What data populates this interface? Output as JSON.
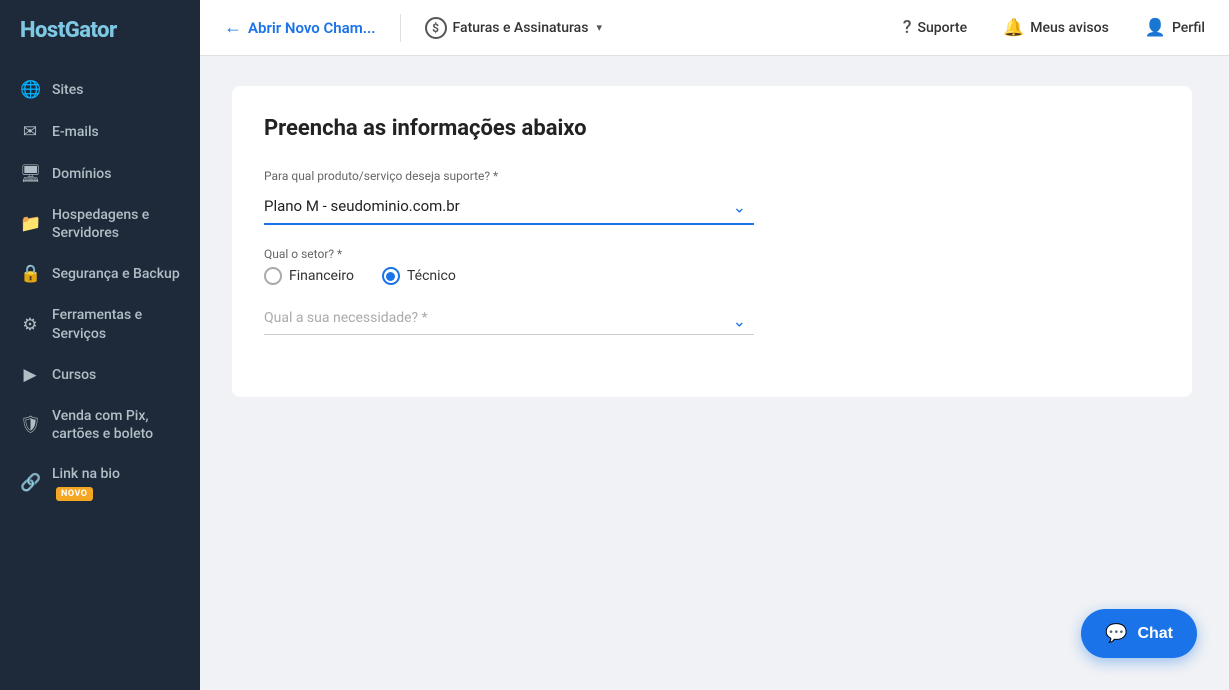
{
  "sidebar": {
    "logo": "HostGator",
    "items": [
      {
        "id": "sites",
        "label": "Sites",
        "icon": "🌐"
      },
      {
        "id": "emails",
        "label": "E-mails",
        "icon": "✉"
      },
      {
        "id": "dominios",
        "label": "Domínios",
        "icon": "🖥"
      },
      {
        "id": "hospedagens",
        "label": "Hospedagens e Servidores",
        "icon": "📁"
      },
      {
        "id": "seguranca",
        "label": "Segurança e Backup",
        "icon": "🔒"
      },
      {
        "id": "ferramentas",
        "label": "Ferramentas e Serviços",
        "icon": "⚙"
      },
      {
        "id": "cursos",
        "label": "Cursos",
        "icon": "▶"
      },
      {
        "id": "venda",
        "label": "Venda com Pix, cartões e boleto",
        "icon": "🛡"
      },
      {
        "id": "linkbio",
        "label": "Link na bio",
        "icon": "🔗",
        "badge": "NOVO"
      }
    ]
  },
  "topbar": {
    "back_label": "Abrir Novo Cham...",
    "faturas_label": "Faturas e Assinaturas",
    "suporte_label": "Suporte",
    "avisos_label": "Meus avisos",
    "perfil_label": "Perfil"
  },
  "form": {
    "title": "Preencha as informações abaixo",
    "product_label": "Para qual produto/serviço deseja suporte? *",
    "product_value": "Plano M - seudominio.com.br",
    "sector_label": "Qual o setor? *",
    "sector_options": [
      {
        "id": "financeiro",
        "label": "Financeiro",
        "selected": false
      },
      {
        "id": "tecnico",
        "label": "Técnico",
        "selected": true
      }
    ],
    "need_label": "Qual a sua necessidade? *",
    "need_placeholder": "Qual a sua necessidade? *"
  },
  "chat": {
    "label": "Chat"
  },
  "colors": {
    "sidebar_bg": "#1e2a3a",
    "accent": "#1a73e8",
    "badge_bg": "#f5a623"
  }
}
